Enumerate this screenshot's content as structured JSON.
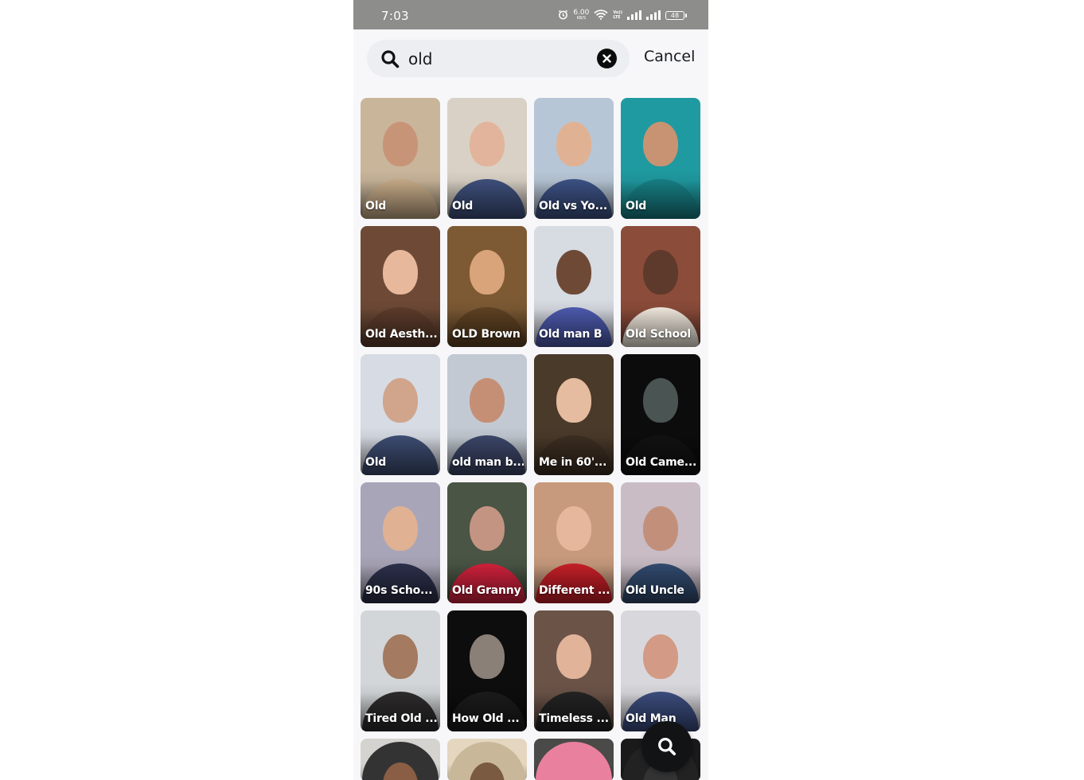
{
  "status_bar": {
    "time": "7:03",
    "net_speed": "6.00",
    "net_unit": "KB/S",
    "volte_top": "Vo))",
    "volte_bottom": "LTE",
    "battery": "48"
  },
  "search": {
    "query": "old",
    "cancel_label": "Cancel"
  },
  "results": [
    {
      "label": "Old",
      "bg": "#c9b59a",
      "skin": "#c89478",
      "top": "#bfa583"
    },
    {
      "label": "Old",
      "bg": "#d9d1c5",
      "skin": "#e2b49c",
      "top": "#3c4d78"
    },
    {
      "label": "Old vs Yo...",
      "bg": "#b7c6d6",
      "skin": "#e0b293",
      "top": "#3a4f80"
    },
    {
      "label": "Old",
      "bg": "#1f9aa0",
      "skin": "#c89372",
      "top": "#167b80"
    },
    {
      "label": "Old Aesth...",
      "bg": "#6e4a36",
      "skin": "#e7b89c",
      "top": "#5a3a2a"
    },
    {
      "label": "OLD Brown",
      "bg": "#7d5a34",
      "skin": "#d9a47a",
      "top": "#5c4022"
    },
    {
      "label": "Old man B",
      "bg": "#d7dbe2",
      "skin": "#6e4a36",
      "top": "#4a57a8"
    },
    {
      "label": "Old School",
      "bg": "#8c4c3a",
      "skin": "#5d3a2c",
      "top": "#e8e0d5"
    },
    {
      "label": "Old",
      "bg": "#d7dbe3",
      "skin": "#d0a58c",
      "top": "#3b4a6e"
    },
    {
      "label": "old man b...",
      "bg": "#c3c9d2",
      "skin": "#c58f76",
      "top": "#3a4465"
    },
    {
      "label": "Me in 60'...",
      "bg": "#4a3a2a",
      "skin": "#e5bca0",
      "top": "#3a2c20"
    },
    {
      "label": "Old Came...",
      "bg": "#0c0c0c",
      "skin": "#4a5452",
      "top": "#111111"
    },
    {
      "label": "90s Scho...",
      "bg": "#a9a5b8",
      "skin": "#e0b193",
      "top": "#2b2e48"
    },
    {
      "label": "Old Granny",
      "bg": "#4a5545",
      "skin": "#c49483",
      "top": "#c9203a"
    },
    {
      "label": "Different ...",
      "bg": "#c79a7d",
      "skin": "#e6b79c",
      "top": "#c01e26"
    },
    {
      "label": "Old Uncle",
      "bg": "#c9bcc5",
      "skin": "#c2907a",
      "top": "#30486b"
    },
    {
      "label": "Tired Old ...",
      "bg": "#d3d6d8",
      "skin": "#a47a60",
      "top": "#2c2a2a"
    },
    {
      "label": "How Old ...",
      "bg": "#0d0d0d",
      "skin": "#8a8078",
      "top": "#1a1a1a"
    },
    {
      "label": "Timeless ...",
      "bg": "#6b5348",
      "skin": "#e1b399",
      "top": "#222222"
    },
    {
      "label": "Old Man",
      "bg": "#d8d8dc",
      "skin": "#d39a86",
      "top": "#3a4a7a"
    },
    {
      "label": "",
      "bg": "#d5d3d0",
      "skin": "#8a5e45",
      "top": "#333333"
    },
    {
      "label": "",
      "bg": "#e4d6bf",
      "skin": "#7a5a40",
      "top": "#c9b79a"
    },
    {
      "label": "",
      "bg": "#4a4a48",
      "skin": "#e9819e",
      "top": "#e9819e"
    },
    {
      "label": "",
      "bg": "#1a1a1a",
      "skin": "#333333",
      "top": "#222222"
    }
  ],
  "accent": {
    "fab": "#111315",
    "search_bg": "#eceef1"
  }
}
